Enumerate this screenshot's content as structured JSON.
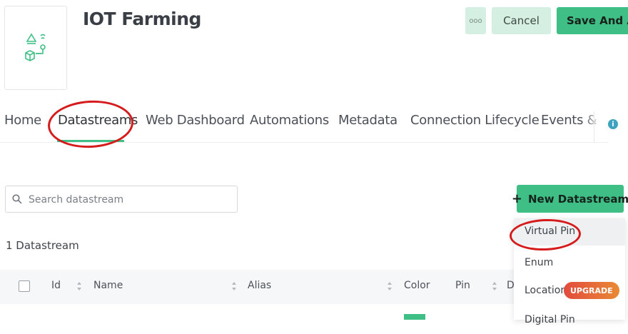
{
  "header": {
    "title": "IOT Farming",
    "more_label": "ooo",
    "cancel_label": "Cancel",
    "save_label": "Save And Apply",
    "icon": "iot-product-icon"
  },
  "tabs": [
    {
      "label": "Home"
    },
    {
      "label": "Datastreams",
      "active": true
    },
    {
      "label": "Web Dashboard"
    },
    {
      "label": "Automations"
    },
    {
      "label": "Metadata"
    },
    {
      "label": "Connection Lifecycle"
    },
    {
      "label": "Events & N"
    }
  ],
  "info_icon": "i",
  "search": {
    "placeholder": "Search datastream",
    "value": ""
  },
  "new_datastream": {
    "plus": "+",
    "label": "New Datastream"
  },
  "count_label": "1 Datastream",
  "table": {
    "columns": [
      "Id",
      "Name",
      "Alias",
      "Color",
      "Pin",
      "D"
    ]
  },
  "dropdown": {
    "items": [
      {
        "label": "Virtual Pin"
      },
      {
        "label": "Enum"
      },
      {
        "label": "Location",
        "badge": "UPGRADE"
      },
      {
        "label": "Digital Pin"
      }
    ]
  },
  "colors": {
    "accent": "#3fbf85",
    "accent_light": "#d6efe3",
    "annotation": "#d51b1b",
    "upgrade_start": "#e24b3d",
    "upgrade_end": "#e98a35"
  }
}
